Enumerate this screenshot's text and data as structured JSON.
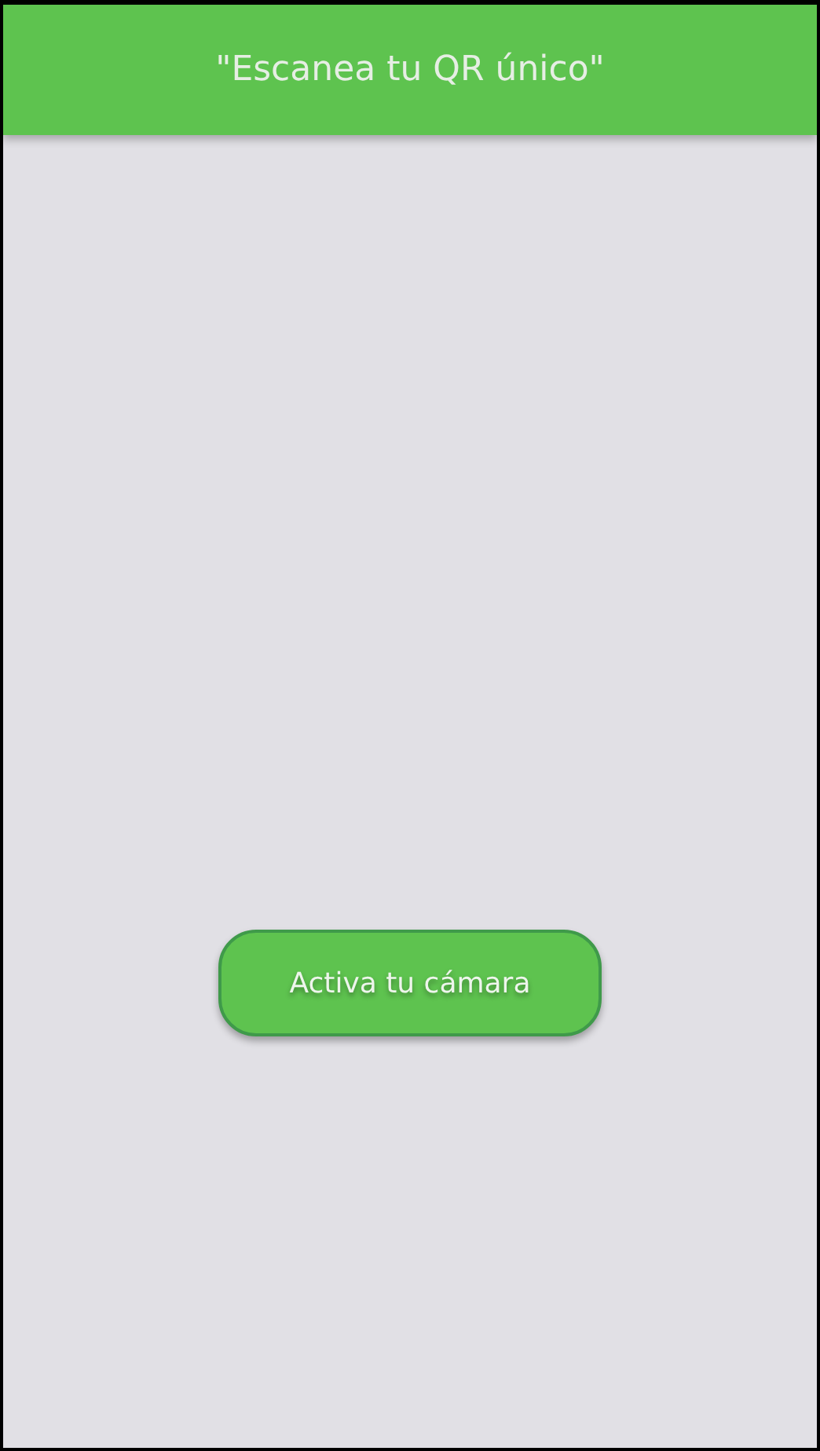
{
  "header": {
    "title": "\"Escanea tu QR único\""
  },
  "button": {
    "label": "Activa tu cámara"
  }
}
